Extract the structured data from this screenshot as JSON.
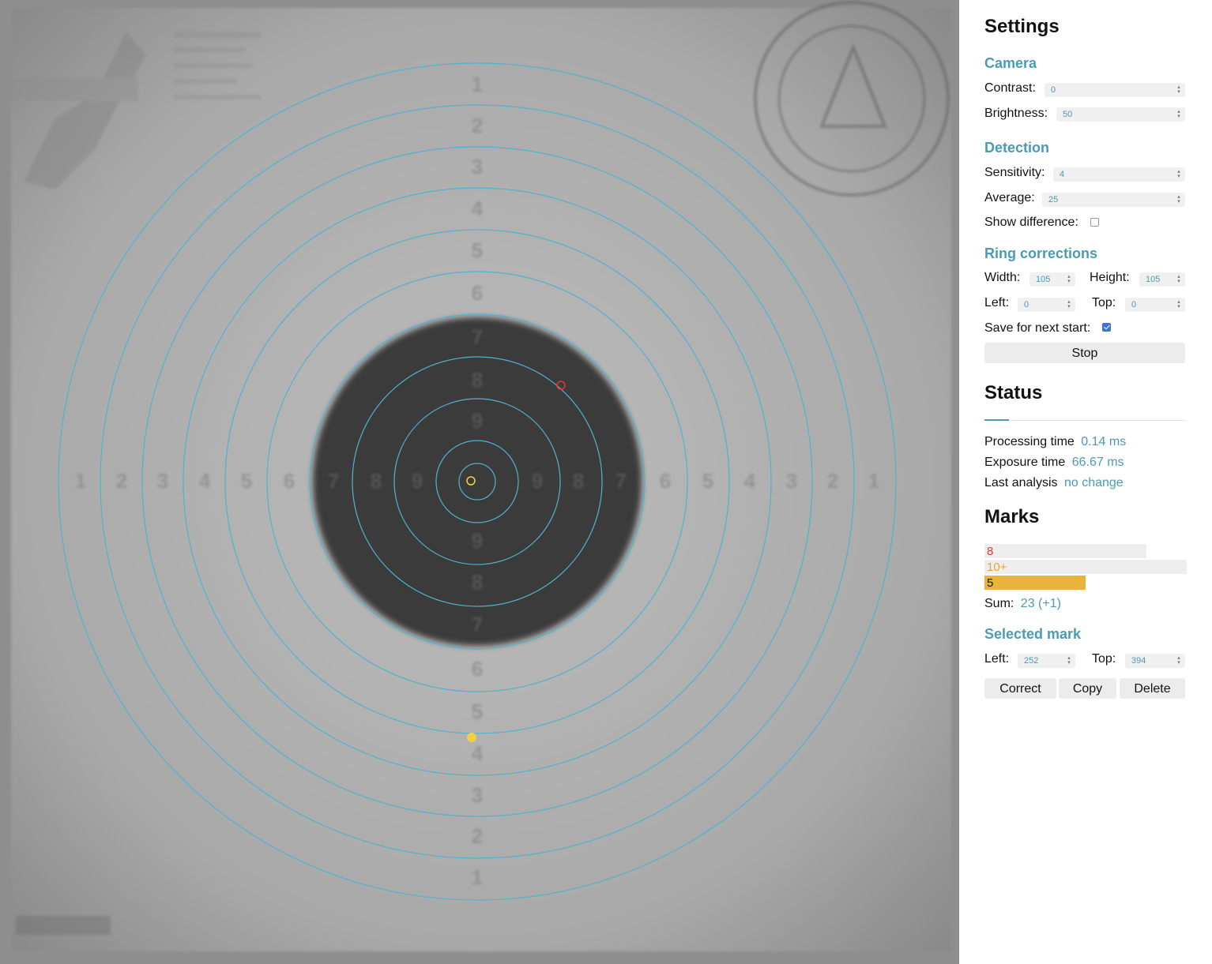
{
  "target": {
    "ring_color": "#4fb3cf",
    "center_marker_color": "#f2cf45",
    "marks": [
      {
        "label_color": "#e03a2f",
        "kind": "ring"
      },
      {
        "label_color": "#f2cf45",
        "kind": "ring"
      },
      {
        "label_color": "#f2cf45",
        "kind": "filled"
      }
    ],
    "ring_numbers": [
      "1",
      "2",
      "3",
      "4",
      "5",
      "6",
      "7",
      "8",
      "9"
    ]
  },
  "settings": {
    "title": "Settings",
    "camera": {
      "heading": "Camera",
      "contrast_label": "Contrast:",
      "contrast_value": "0",
      "brightness_label": "Brightness:",
      "brightness_value": "50"
    },
    "detection": {
      "heading": "Detection",
      "sensitivity_label": "Sensitivity:",
      "sensitivity_value": "4",
      "average_label": "Average:",
      "average_value": "25",
      "show_difference_label": "Show difference:",
      "show_difference_checked": false
    },
    "ring_corrections": {
      "heading": "Ring corrections",
      "width_label": "Width:",
      "width_value": "105",
      "height_label": "Height:",
      "height_value": "105",
      "left_label": "Left:",
      "left_value": "0",
      "top_label": "Top:",
      "top_value": "0",
      "save_label": "Save for next start:",
      "save_checked": true
    },
    "stop_label": "Stop"
  },
  "status": {
    "title": "Status",
    "processing_label": "Processing time",
    "processing_value": "0.14 ms",
    "exposure_label": "Exposure time",
    "exposure_value": "66.67 ms",
    "last_label": "Last analysis",
    "last_value": "no change"
  },
  "marks": {
    "title": "Marks",
    "items": [
      {
        "label": "8",
        "color": "#e03a2f",
        "fill_fraction": 0.8,
        "bar_color": "#eeeeee"
      },
      {
        "label": "10+",
        "color": "#e8a13a",
        "fill_fraction": 1.0,
        "bar_color": "#eeeeee"
      },
      {
        "label": "5",
        "color": "#111111",
        "fill_fraction": 0.5,
        "bar_color": "#e8b43c"
      }
    ],
    "sum_label": "Sum:",
    "sum_value": "23 (+1)"
  },
  "selected_mark": {
    "heading": "Selected mark",
    "left_label": "Left:",
    "left_value": "252",
    "top_label": "Top:",
    "top_value": "394",
    "correct_label": "Correct",
    "copy_label": "Copy",
    "delete_label": "Delete"
  }
}
